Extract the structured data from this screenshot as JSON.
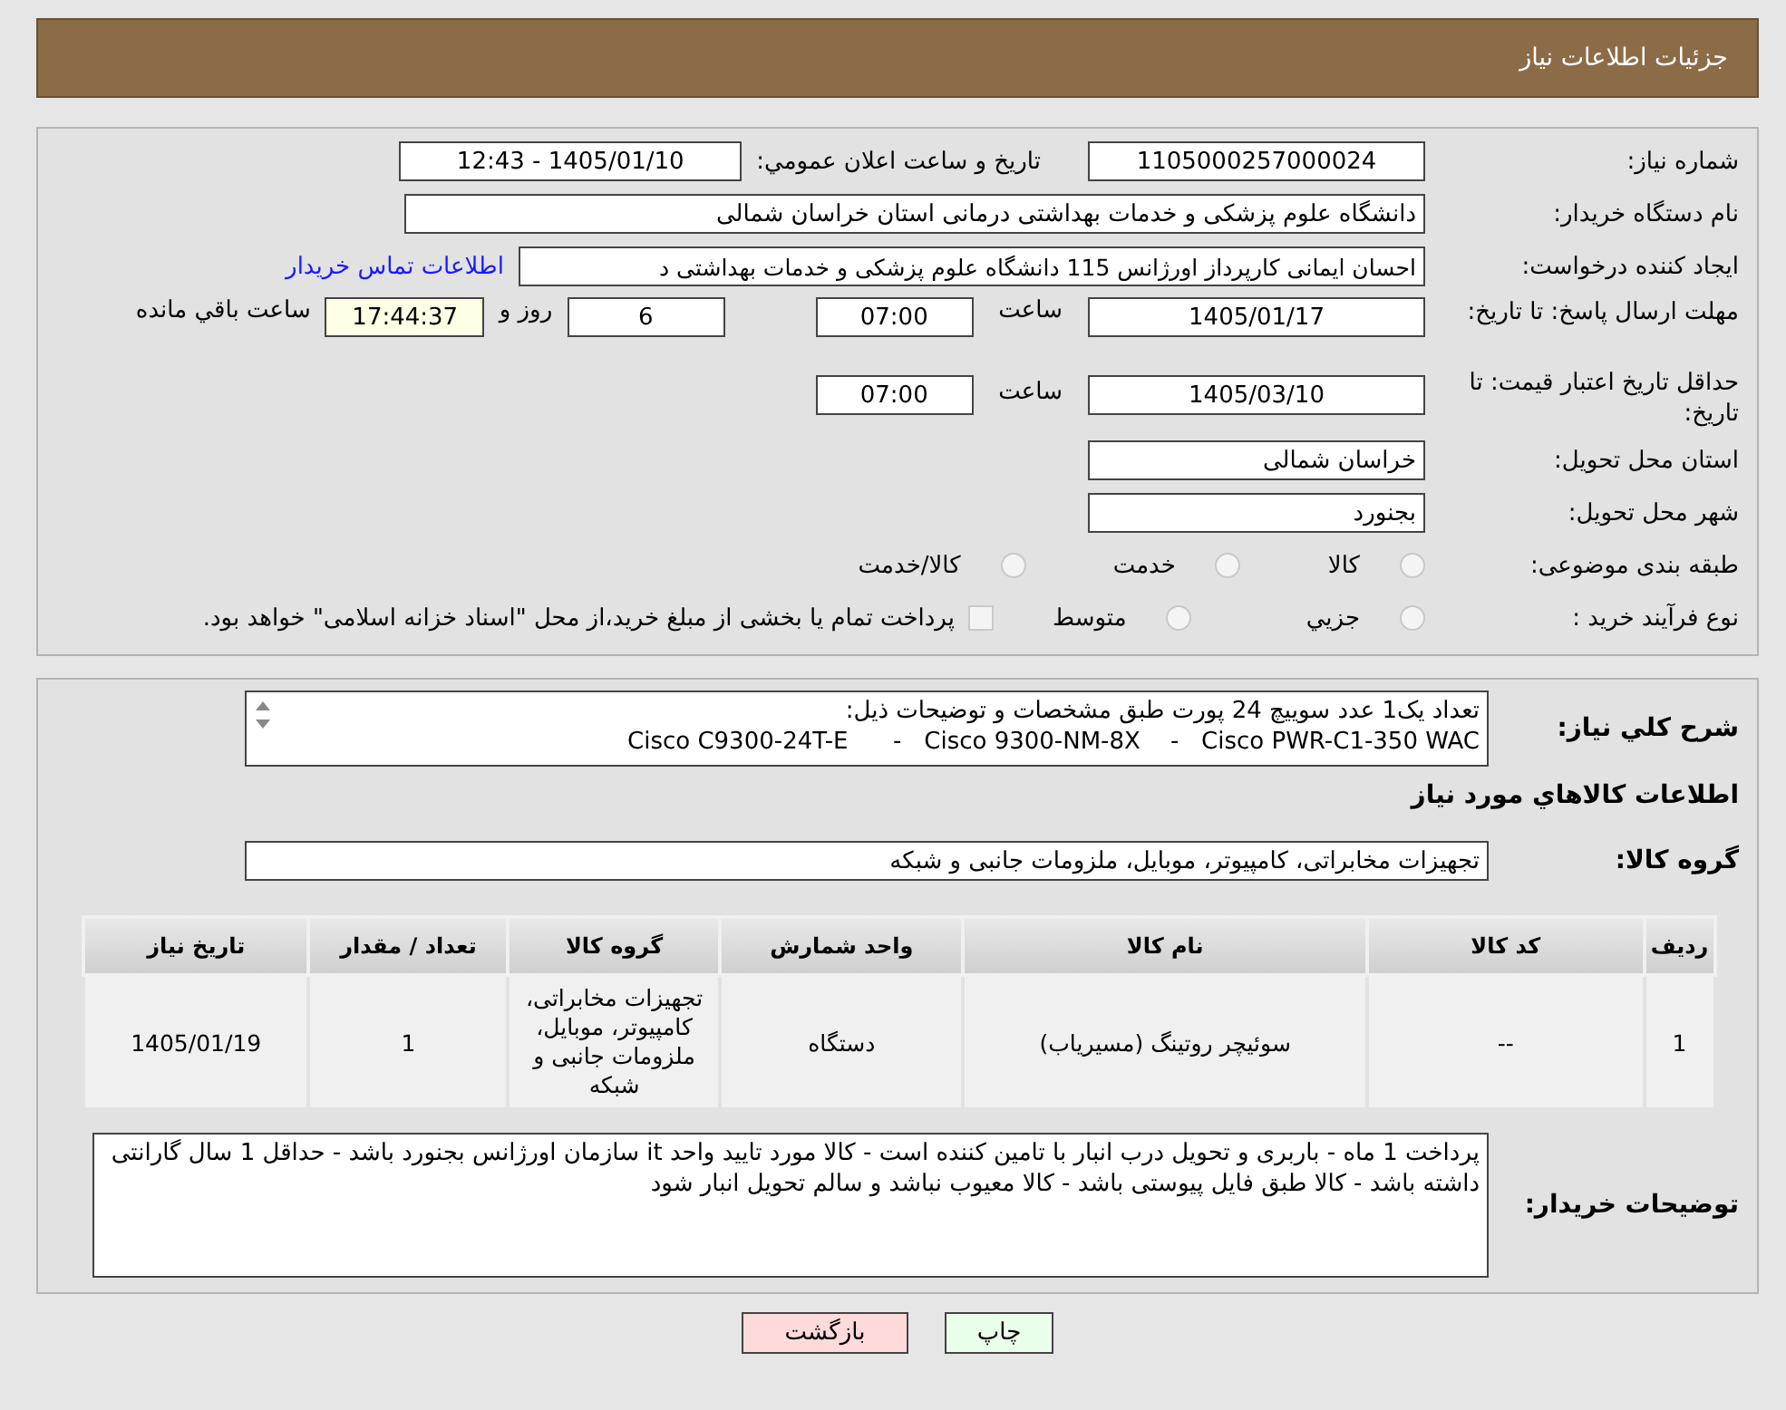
{
  "header": {
    "title": "جزئیات اطلاعات نیاز"
  },
  "details": {
    "need_number": {
      "label": "شماره نیاز:",
      "value": "1105000257000024"
    },
    "announce": {
      "label": "تاريخ و ساعت اعلان عمومي:",
      "value": "1405/01/10 - 12:43"
    },
    "buyer": {
      "label": "نام دستگاه خریدار:",
      "value": "دانشگاه علوم پزشکی و خدمات بهداشتی درمانی استان خراسان شمالی"
    },
    "creator": {
      "label": "ایجاد کننده درخواست:",
      "value": "احسان ایمانی کارپرداز اورژانس 115 دانشگاه علوم پزشکی و خدمات بهداشتی د",
      "link": "اطلاعات تماس خریدار"
    },
    "deadline": {
      "label": "مهلت ارسال پاسخ: تا تاریخ:",
      "date": "1405/01/17",
      "time_label": "ساعت",
      "time": "07:00",
      "days": "6",
      "days_label": "روز و",
      "remaining": "17:44:37",
      "remaining_label": "ساعت باقي مانده"
    },
    "validity": {
      "label": "حداقل تاریخ اعتبار قیمت: تا تاریخ:",
      "date": "1405/03/10",
      "time_label": "ساعت",
      "time": "07:00"
    },
    "province": {
      "label": "استان محل تحویل:",
      "value": "خراسان شمالی"
    },
    "city": {
      "label": "شهر محل تحویل:",
      "value": "بجنورد"
    },
    "category": {
      "label": "طبقه بندی موضوعی:",
      "options": [
        {
          "label": "کالا",
          "selected": false
        },
        {
          "label": "خدمت",
          "selected": false
        },
        {
          "label": "کالا/خدمت",
          "selected": false
        }
      ]
    },
    "process": {
      "label": "نوع فرآیند خرید :",
      "options": [
        {
          "label": "جزيي",
          "selected": false
        },
        {
          "label": "متوسط",
          "selected": false
        }
      ],
      "treasury": {
        "label": "پرداخت تمام یا بخشی از مبلغ خرید،از محل \"اسناد خزانه اسلامی\" خواهد بود.",
        "checked": false
      }
    }
  },
  "needs": {
    "summary": {
      "label": "شرح كلي نياز:",
      "lines": [
        "تعداد یک1 عدد سوییچ 24 پورت طبق مشخصات و توضیحات ذیل:",
        "Cisco C9300-24T-E      -   Cisco 9300-NM-8X    -   Cisco PWR-C1-350 WAC"
      ]
    },
    "section_title": "اطلاعات كالاهاي مورد نياز",
    "group": {
      "label": "گروه کالا:",
      "value": "تجهیزات مخابراتی، کامپیوتر، موبایل، ملزومات جانبی و شبکه"
    },
    "table": {
      "columns": [
        "ردیف",
        "کد کالا",
        "نام کالا",
        "واحد شمارش",
        "گروه کالا",
        "تعداد / مقدار",
        "تاریخ نیاز"
      ],
      "rows": [
        [
          "1",
          "--",
          "سوئیچر روتینگ (مسیریاب)",
          "دستگاه",
          "تجهیزات مخابراتی، کامپیوتر، موبایل، ملزومات جانبی و شبکه",
          "1",
          "1405/01/19"
        ]
      ]
    },
    "notes": {
      "label": "توضیحات خریدار:",
      "value": "پرداخت 1 ماه - باربری و تحویل درب انبار با تامین کننده است - کالا مورد تایید واحد it سازمان اورژانس بجنورد باشد - حداقل 1 سال گارانتی داشته باشد - کالا طبق فایل پیوستی باشد - کالا معیوب نباشد و سالم تحویل انبار شود"
    }
  },
  "buttons": [
    {
      "label": "چاپ",
      "kind": "print"
    },
    {
      "label": "بازگشت",
      "kind": "back"
    }
  ]
}
